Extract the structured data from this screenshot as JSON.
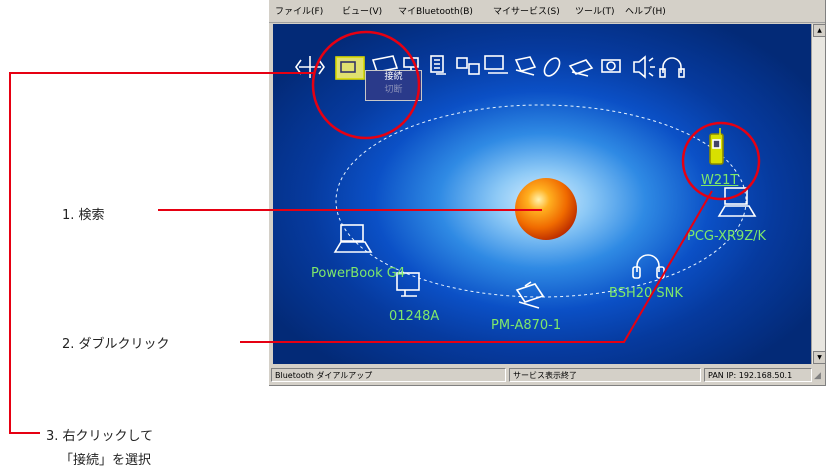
{
  "menubar": [
    "ファイル(F)",
    "ビュー(V)",
    "マイBluetooth(B)",
    "マイサービス(S)",
    "ツール(T)",
    "ヘルプ(H)"
  ],
  "context_menu": {
    "connect": "接続",
    "disconnect": "切断"
  },
  "devices": {
    "phone": "W21T",
    "laptop_right": "PCG-XR9Z/K",
    "laptop_left": "PowerBook G4",
    "desktop": "01248A",
    "printer": "PM-A870-1",
    "headset": "BSH20 SNK"
  },
  "statusbar": {
    "left": "Bluetooth ダイアルアップ",
    "middle": "サービス表示終了",
    "right": "PAN IP: 192.168.50.1"
  },
  "annotations": {
    "step1": "1.  検索",
    "step2": "2.  ダブルクリック",
    "step3_line1": "3.  右クリックして",
    "step3_line2": "「接続」を選択"
  },
  "colors": {
    "annotation_red": "#e60012",
    "device_label_green": "#7fe86a",
    "sphere": "#f06a00"
  }
}
